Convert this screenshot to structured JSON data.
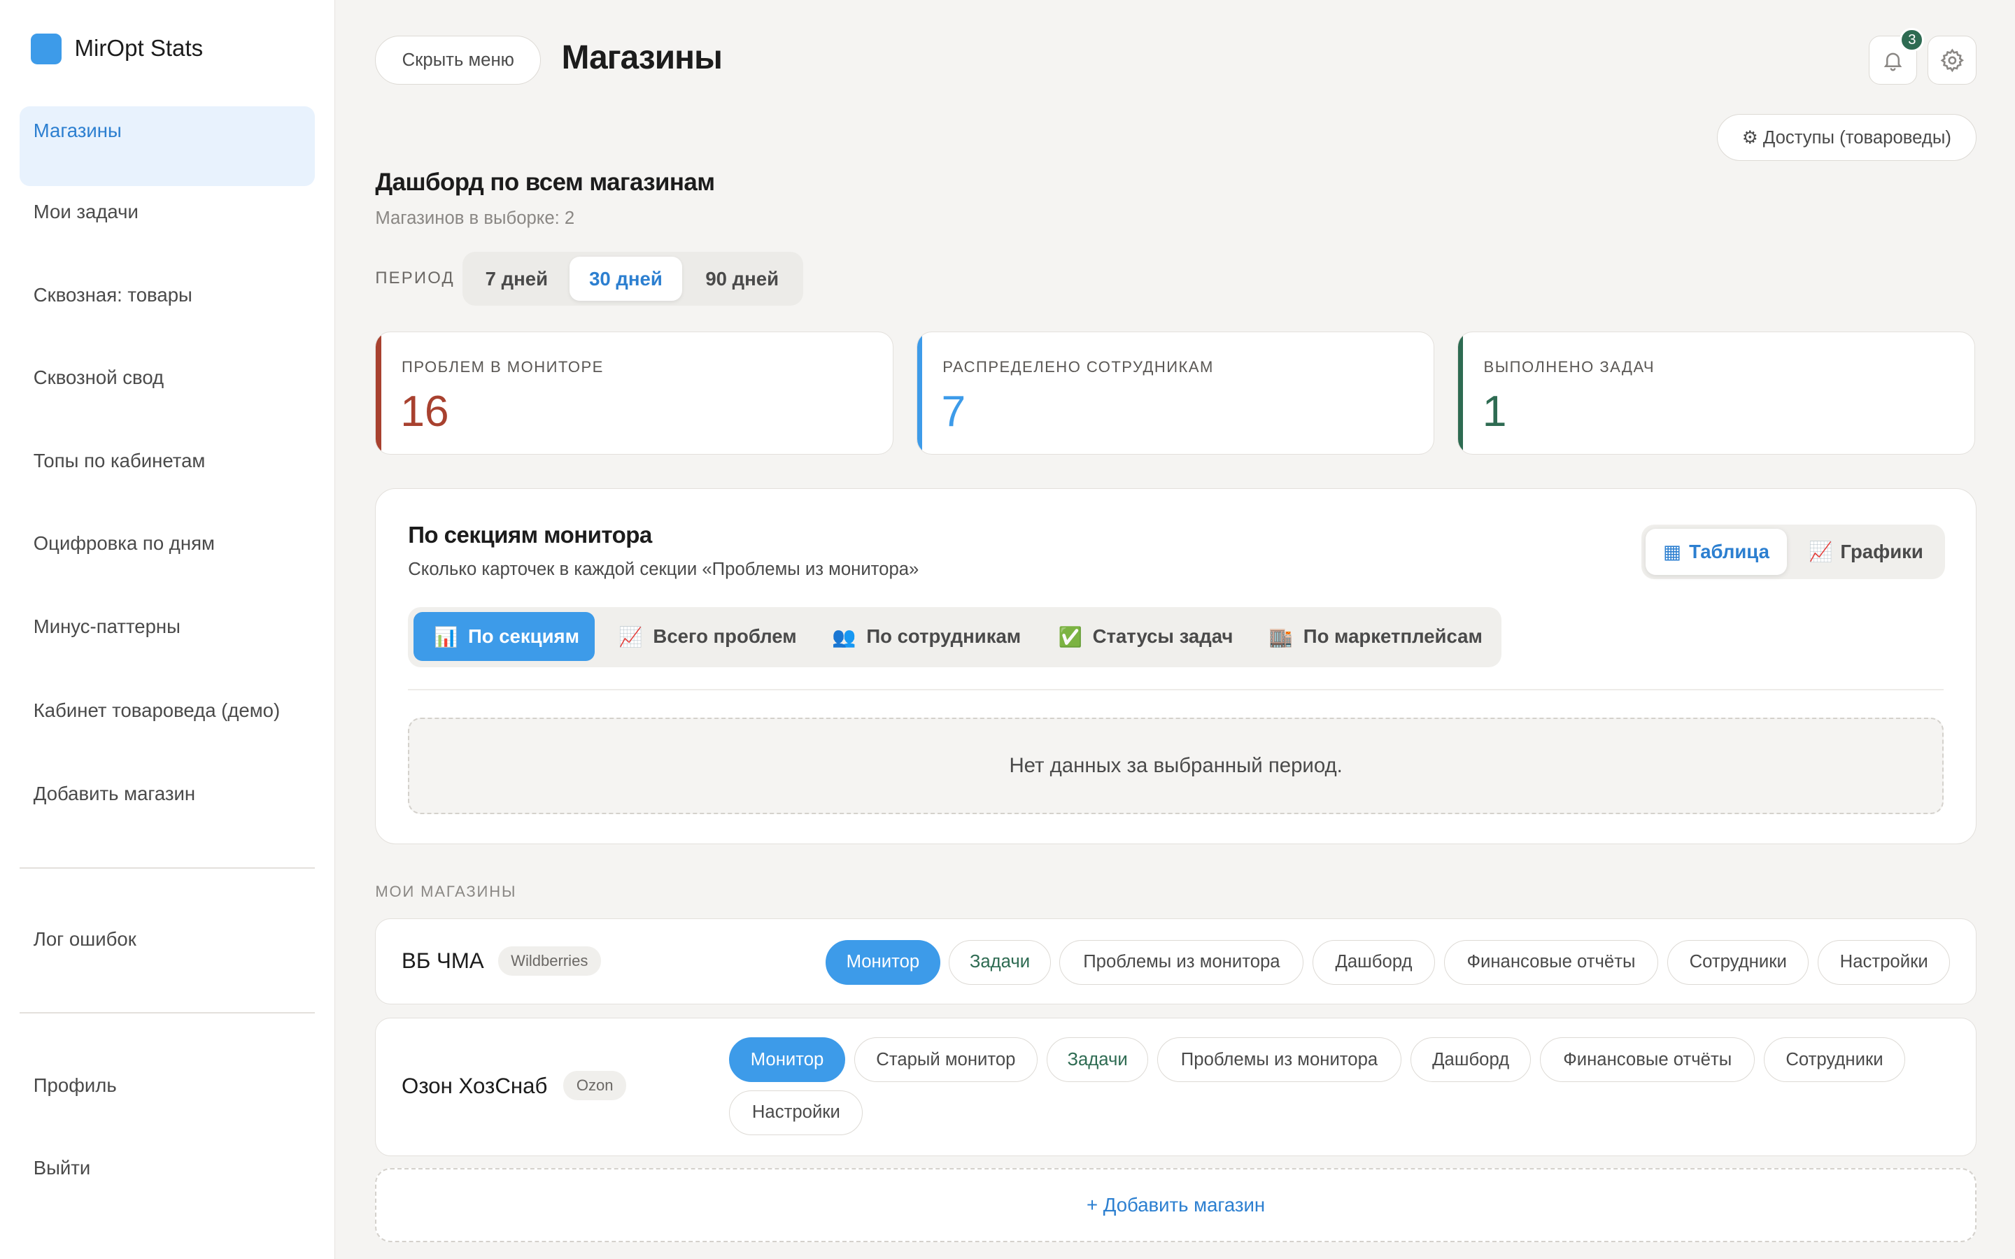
{
  "app": {
    "name": "MirOpt Stats"
  },
  "sidebar": {
    "items": [
      {
        "label": "Магазины"
      },
      {
        "label": "Мои задачи"
      },
      {
        "label": "Сквозная: товары"
      },
      {
        "label": "Сквозной свод"
      },
      {
        "label": "Топы по кабинетам"
      },
      {
        "label": "Оцифровка по дням"
      },
      {
        "label": "Минус-паттерны"
      },
      {
        "label": "Кабинет товароведа (демо)"
      },
      {
        "label": "Добавить магазин"
      }
    ],
    "log_label": "Лог ошибок",
    "profile_label": "Профиль",
    "logout_label": "Выйти"
  },
  "header": {
    "hide_menu_label": "Скрыть меню",
    "title": "Магазины",
    "notification_count": "3",
    "access_label": "⚙ Доступы (товароведы)"
  },
  "dashboard": {
    "title": "Дашборд по всем магазинам",
    "subtitle": "Магазинов в выборке: 2",
    "period_label": "ПЕРИОД",
    "periods": [
      "7 дней",
      "30 дней",
      "90 дней"
    ],
    "selected_period": "30 дней"
  },
  "stats": [
    {
      "label": "ПРОБЛЕМ В МОНИТОРЕ",
      "value": "16",
      "color": "#a8412f"
    },
    {
      "label": "РАСПРЕДЕЛЕНО СОТРУДНИКАМ",
      "value": "7",
      "color": "#3d9be9"
    },
    {
      "label": "ВЫПОЛНЕНО ЗАДАЧ",
      "value": "1",
      "color": "#2e6b52"
    }
  ],
  "monitor_panel": {
    "title": "По секциям монитора",
    "subtitle": "Сколько карточек в каждой секции «Проблемы из монитора»",
    "views": [
      {
        "icon": "▦",
        "label": "Таблица"
      },
      {
        "icon": "📈",
        "label": "Графики"
      }
    ],
    "tabs": [
      {
        "icon": "📊",
        "label": "По секциям"
      },
      {
        "icon": "📈",
        "label": "Всего проблем"
      },
      {
        "icon": "👥",
        "label": "По сотрудникам"
      },
      {
        "icon": "✅",
        "label": "Статусы задач"
      },
      {
        "icon": "🏬",
        "label": "По маркетплейсам"
      }
    ],
    "empty_text": "Нет данных за выбранный период."
  },
  "shops_section": {
    "label": "МОИ МАГАЗИНЫ",
    "shops": [
      {
        "name": "ВБ ЧМА",
        "tag": "Wildberries",
        "actions": [
          "Монитор",
          "Задачи",
          "Проблемы из монитора",
          "Дашборд",
          "Финансовые отчёты",
          "Сотрудники",
          "Настройки"
        ]
      },
      {
        "name": "Озон ХозСнаб",
        "tag": "Ozon",
        "actions": [
          "Монитор",
          "Старый монитор",
          "Задачи",
          "Проблемы из монитора",
          "Дашборд",
          "Финансовые отчёты",
          "Сотрудники",
          "Настройки"
        ]
      }
    ],
    "add_label": "+ Добавить магазин"
  },
  "colors": {
    "accent": "#3d9be9",
    "active_bg": "#e8f2fd",
    "success": "#2e6b52",
    "danger": "#a8412f"
  }
}
